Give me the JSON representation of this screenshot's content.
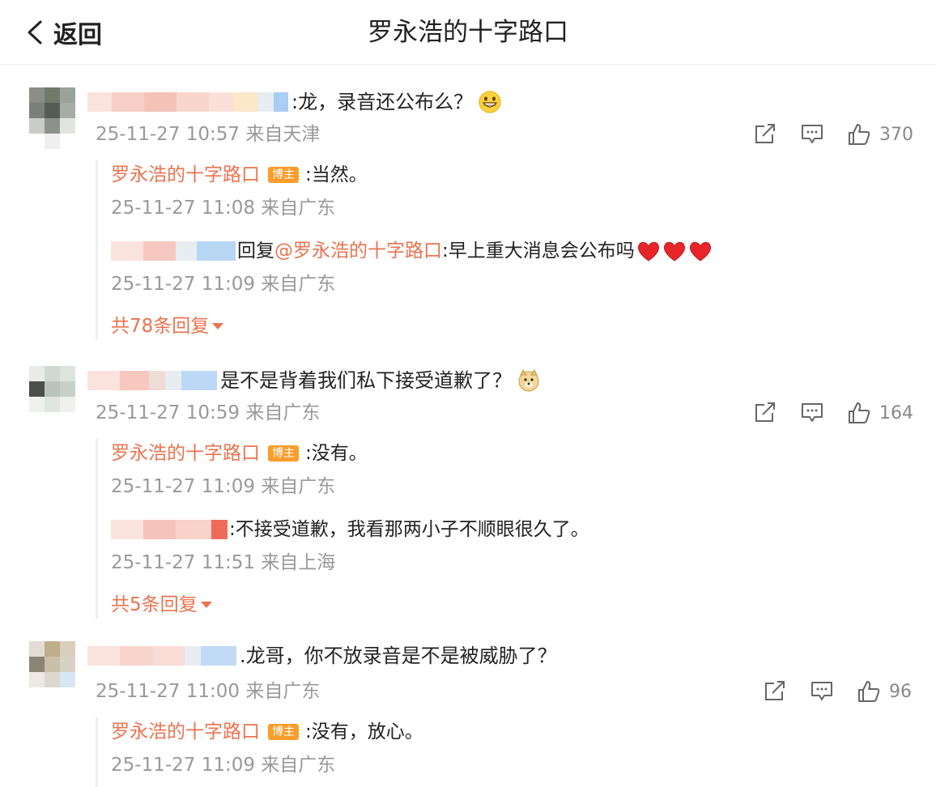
{
  "header": {
    "back_label": "返回",
    "title": "罗永浩的十字路口"
  },
  "comments": [
    {
      "text": ":龙，录音还公布么？",
      "emoji": "grinning-face-icon",
      "time": "25-11-27 10:57",
      "location": "来自天津",
      "likes": "370",
      "replies": [
        {
          "author": "罗永浩的十字路口",
          "badge": "博主",
          "text": ":当然。",
          "time": "25-11-27 11:08 来自广东"
        },
        {
          "prefix": "回复",
          "mention": "@罗永浩的十字路口",
          "text": ":早上重大消息会公布吗",
          "emoji": "heart-icon x3",
          "time": "25-11-27 11:09 来自广东"
        }
      ],
      "more_label": "共78条回复"
    },
    {
      "text": "是不是背着我们私下接受道歉了？",
      "emoji": "doge-icon",
      "time": "25-11-27 10:59",
      "location": "来自广东",
      "likes": "164",
      "replies": [
        {
          "author": "罗永浩的十字路口",
          "badge": "博主",
          "text": ":没有。",
          "time": "25-11-27 11:09 来自广东"
        },
        {
          "text": ":不接受道歉，我看那两小子不顺眼很久了。",
          "time": "25-11-27 11:51 来自上海"
        }
      ],
      "more_label": "共5条回复"
    },
    {
      "text": ".龙哥，你不放录音是不是被威胁了？",
      "time": "25-11-27 11:00",
      "location": "来自广东",
      "likes": "96",
      "replies": [
        {
          "author": "罗永浩的十字路口",
          "badge": "博主",
          "text": ":没有，放心。",
          "time": "25-11-27 11:09 来自广东"
        }
      ]
    }
  ],
  "colors": {
    "accent": "#eb7350",
    "badge": "#fa9d2c",
    "meta": "#999999"
  }
}
